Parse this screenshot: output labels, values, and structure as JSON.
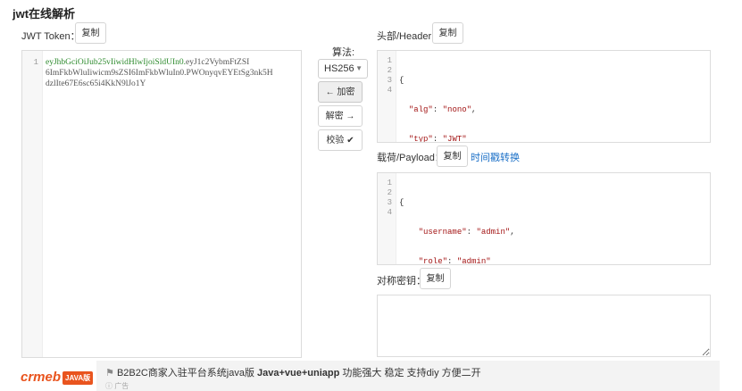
{
  "page": {
    "title": "jwt在线解析"
  },
  "token_panel": {
    "label": "JWT Token：",
    "copy_label": "复制",
    "line_number": "1",
    "token_line1_green": "eyJhbGciOiJub25vIiwidHlwIjoiSldUIn0.",
    "token_line1_rest": "eyJ1c2VybmFtZSI",
    "token_line2": "6ImFkbWluIiwicm9sZSI6ImFkbWluIn0.PWOnyqvEYEtSg3nk5H",
    "token_line3": "dzlIte67E6sc65i4KkN9lJo1Y"
  },
  "controls": {
    "algo_label": "算法:",
    "algo_selected": "HS256",
    "encrypt_label": "加密",
    "decrypt_label": "解密",
    "verify_label": "校验"
  },
  "header_panel": {
    "label": "头部/Header：",
    "copy_label": "复制",
    "lines": [
      "1",
      "2",
      "3",
      "4"
    ],
    "open_brace": "{",
    "alg_key": "\"alg\"",
    "alg_val": "\"nono\"",
    "typ_key": "\"typ\"",
    "typ_val": "\"JWT\"",
    "close_brace": "}"
  },
  "payload_panel": {
    "label": "载荷/Payload：",
    "copy_label": "复制",
    "time_link": "时间戳转换",
    "lines": [
      "1",
      "2",
      "3",
      "4"
    ],
    "open_brace": "{",
    "username_key": "\"username\"",
    "username_val": "\"admin\"",
    "role_key": "\"role\"",
    "role_val": "\"admin\"",
    "close_brace": "}"
  },
  "secret_panel": {
    "label": "对称密钥：",
    "copy_label": "复制",
    "value": ""
  },
  "ad": {
    "logo_text": "crmeb",
    "logo_badge": "JAVA版",
    "text_prefix": "B2B2C商家入驻平台系统java版 ",
    "text_bold": "Java+vue+uniapp",
    "text_suffix": " 功能强大 稳定 支持diy 方便二开",
    "sub_label": "广告"
  },
  "colors": {
    "green_token": "#2e8b2e",
    "string_red": "#a31515",
    "link_blue": "#1a6fc7",
    "ad_orange": "#e9541e"
  }
}
